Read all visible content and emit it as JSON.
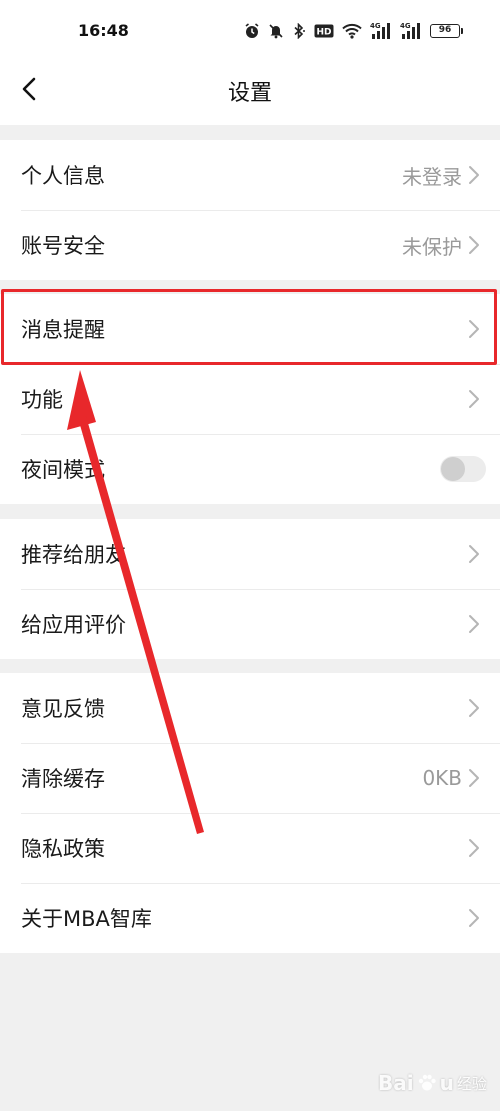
{
  "status_bar": {
    "time": "16:48",
    "battery": "96",
    "icons": [
      "alarm-icon",
      "mute-icon",
      "bluetooth-icon",
      "hd-icon",
      "wifi-icon",
      "signal-4g-icon",
      "signal-4g-icon",
      "battery-icon"
    ]
  },
  "nav": {
    "title": "设置",
    "back_icon": "chevron-left-icon"
  },
  "groups": [
    {
      "items": [
        {
          "label": "个人信息",
          "value": "未登录"
        },
        {
          "label": "账号安全",
          "value": "未保护"
        }
      ]
    },
    {
      "items": [
        {
          "label": "消息提醒",
          "value": ""
        },
        {
          "label": "功能",
          "value": ""
        },
        {
          "label": "夜间模式",
          "value": "",
          "toggle": false
        }
      ]
    },
    {
      "items": [
        {
          "label": "推荐给朋友",
          "value": ""
        },
        {
          "label": "给应用评价",
          "value": ""
        }
      ]
    },
    {
      "items": [
        {
          "label": "意见反馈",
          "value": ""
        },
        {
          "label": "清除缓存",
          "value": "0KB"
        },
        {
          "label": "隐私政策",
          "value": ""
        },
        {
          "label": "关于MBA智库",
          "value": ""
        }
      ]
    }
  ],
  "annotation": {
    "highlight_color": "#e8282b",
    "arrow_color": "#e8282b"
  },
  "watermark": {
    "brand": "Bai",
    "brand_end": "u",
    "sub": "经验"
  }
}
